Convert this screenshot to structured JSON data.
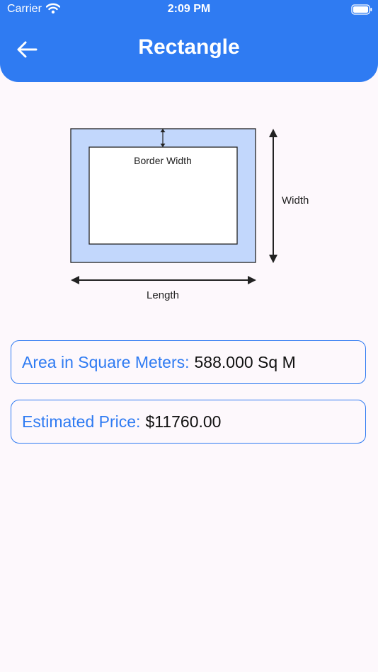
{
  "status_bar": {
    "carrier": "Carrier",
    "time": "2:09 PM"
  },
  "header": {
    "title": "Rectangle",
    "back_icon": "arrow-left-icon",
    "background_color": "#2F7BF2"
  },
  "diagram": {
    "border_width_label": "Border Width",
    "width_label": "Width",
    "length_label": "Length",
    "border_fill_color": "#C2D7FC"
  },
  "results": {
    "area_label": "Area in Square Meters:",
    "area_value": "588.000 Sq M",
    "price_label": "Estimated Price:",
    "price_value": "$11760.00"
  },
  "colors": {
    "accent": "#2F7BF2",
    "background": "#FDF8FC"
  }
}
